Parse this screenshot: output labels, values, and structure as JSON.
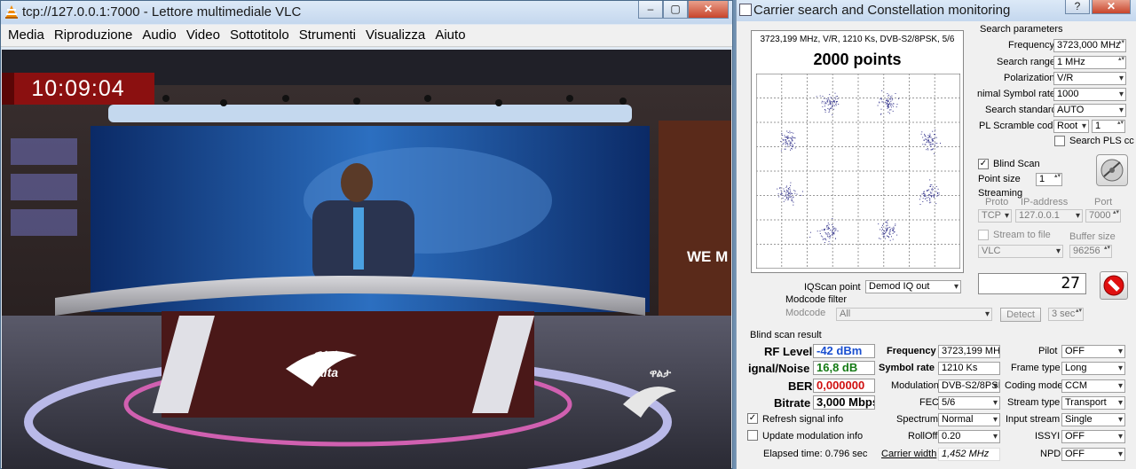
{
  "vlc": {
    "title": "tcp://127.0.0.1:7000 - Lettore multimediale VLC",
    "menu": [
      "Media",
      "Riproduzione",
      "Audio",
      "Video",
      "Sottotitolo",
      "Strumenti",
      "Visualizza",
      "Aiuto"
    ],
    "clock": "10:09:04",
    "ticker_text": "WE M",
    "logo_text": "ዋልታ",
    "logo_sub": "walta"
  },
  "carrier": {
    "title": "Carrier search and Constellation monitoring",
    "help_label": "?",
    "close_label": "✕",
    "plot": {
      "info": "3723,199 MHz, V/R, 1210 Ks, DVB-S2/8PSK, 5/6",
      "points_title": "2000 points"
    },
    "search_params": {
      "group_label": "Search parameters",
      "frequency_label": "Frequency",
      "frequency_value": "3723,000 MHz",
      "search_range_label": "Search range",
      "search_range_value": "1 MHz",
      "polarization_label": "Polarization",
      "polarization_value": "V/R",
      "min_symbol_rate_label": "nimal Symbol rate",
      "min_symbol_rate_value": "1000",
      "search_standard_label": "Search standard",
      "search_standard_value": "AUTO",
      "pl_scramble_label": "PL Scramble code",
      "pl_scramble_mode": "Root",
      "pl_scramble_value": "1",
      "search_pls_label": "Search PLS cc"
    },
    "blind_scan_label": "Blind Scan",
    "point_size_label": "Point size",
    "point_size_value": "1",
    "streaming": {
      "label": "Streaming",
      "proto_label": "Proto",
      "ip_label": "IP-address",
      "port_label": "Port",
      "proto_value": "TCP",
      "ip_value": "127.0.0.1",
      "port_value": "7000",
      "stream_to_file_label": "Stream to file",
      "buffer_size_label": "Buffer size",
      "file_type_value": "VLC",
      "buffer_size_value": "96256"
    },
    "iqscan_label": "IQScan point",
    "iqscan_value": "Demod IQ out",
    "counter_value": "27",
    "modcode": {
      "group_label": "Modcode filter",
      "modcode_label": "Modcode",
      "modcode_value": "All",
      "detect_label": "Detect",
      "seconds_value": "3 sec"
    },
    "result": {
      "group_label": "Blind scan result",
      "rf_level_label": "RF Level",
      "rf_level_value": "-42 dBm",
      "snr_label": "ignal/Noise",
      "snr_value": "16,8 dB",
      "ber_label": "BER",
      "ber_value": "0,000000",
      "bitrate_label": "Bitrate",
      "bitrate_value": "3,000 Mbps",
      "frequency_label": "Frequency",
      "frequency_value": "3723,199 MHz",
      "symbol_rate_label": "Symbol rate",
      "symbol_rate_value": "1210 Ks",
      "modulation_label": "Modulation",
      "modulation_value": "DVB-S2/8PSK",
      "fec_label": "FEC",
      "fec_value": "5/6",
      "spectrum_label": "Spectrum",
      "spectrum_value": "Normal",
      "rolloff_label": "RollOff",
      "rolloff_value": "0.20",
      "carrier_width_label": "Carrier width",
      "carrier_width_value": "1,452 MHz",
      "pilot_label": "Pilot",
      "pilot_value": "OFF",
      "frame_type_label": "Frame type",
      "frame_type_value": "Long",
      "coding_mode_label": "Coding mode",
      "coding_mode_value": "CCM",
      "stream_type_label": "Stream type",
      "stream_type_value": "Transport",
      "input_stream_label": "Input stream",
      "input_stream_value": "Single",
      "issyi_label": "ISSYI",
      "issyi_value": "OFF",
      "npd_label": "NPD",
      "npd_value": "OFF"
    },
    "refresh_signal_label": "Refresh signal info",
    "update_modulation_label": "Update modulation info",
    "elapsed_label": "Elapsed time: 0.796 sec",
    "colors": {
      "rf": "#1a4fd0",
      "snr": "#157a15",
      "ber": "#d01010"
    }
  }
}
